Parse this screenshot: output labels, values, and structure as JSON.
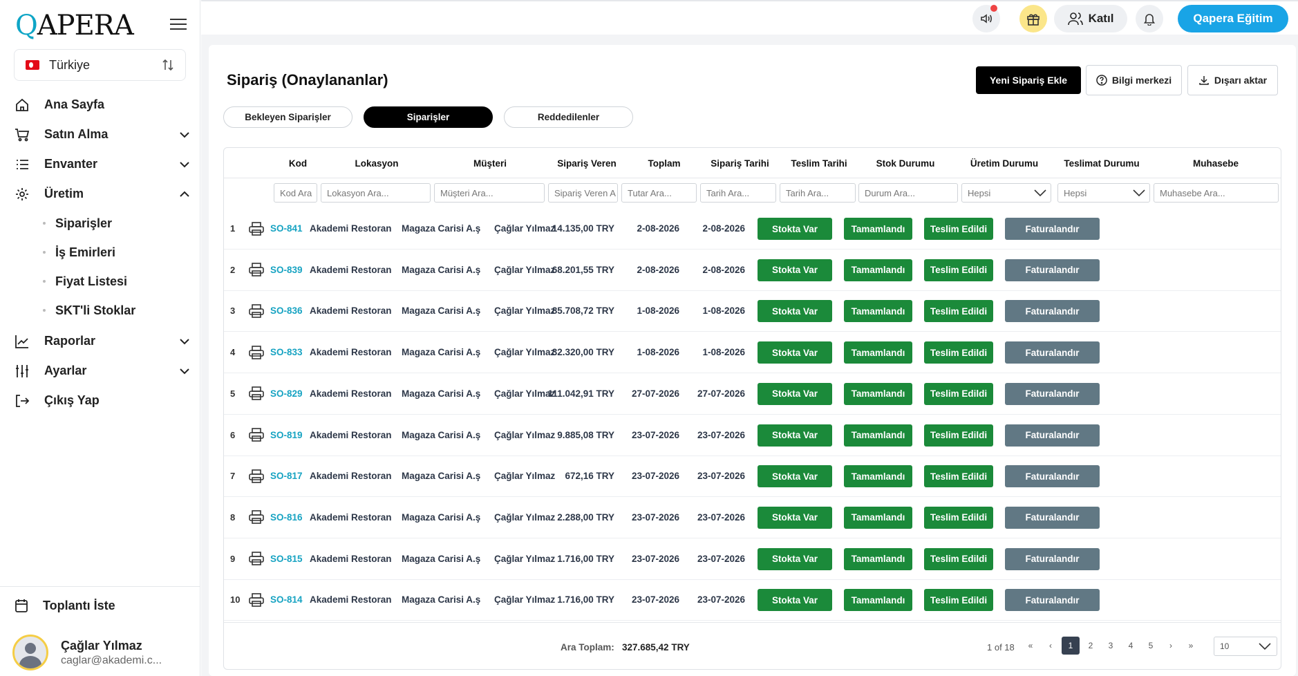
{
  "sidebar": {
    "logo": "QAPERA",
    "country": "Türkiye",
    "nav": [
      {
        "label": "Ana Sayfa",
        "icon": "home-icon"
      },
      {
        "label": "Satın Alma",
        "icon": "cart-icon"
      },
      {
        "label": "Envanter",
        "icon": "list-icon"
      },
      {
        "label": "Üretim",
        "icon": "gear-icon"
      }
    ],
    "sub": [
      "Siparişler",
      "İş Emirleri",
      "Fiyat Listesi",
      "SKT'li Stoklar"
    ],
    "nav2": [
      {
        "label": "Raporlar",
        "icon": "chart-icon"
      },
      {
        "label": "Ayarlar",
        "icon": "sliders-icon"
      },
      {
        "label": "Çıkış Yap",
        "icon": "logout-icon"
      }
    ],
    "meeting": "Toplantı İste",
    "user": {
      "name": "Çağlar Yılmaz",
      "email": "caglar@akademi.c..."
    }
  },
  "topbar": {
    "join": "Katıl",
    "qapera": "Qapera Eğitim"
  },
  "page": {
    "title": "Sipariş (Onaylananlar)",
    "new_order": "Yeni Sipariş Ekle",
    "help": "Bilgi merkezi",
    "export": "Dışarı aktar",
    "tabs": [
      "Bekleyen Siparişler",
      "Siparişler",
      "Reddedilenler"
    ]
  },
  "table": {
    "headers": [
      "Kod",
      "Lokasyon",
      "Müşteri",
      "Sipariş Veren",
      "Toplam",
      "Sipariş Tarihi",
      "Teslim Tarihi",
      "Stok Durumu",
      "Üretim Durumu",
      "Teslimat Durumu",
      "Muhasebe"
    ],
    "filters": [
      "Kod Ara",
      "Lokasyon Ara...",
      "Müşteri Ara...",
      "Sipariş Veren A",
      "Tutar Ara...",
      "Tarih Ara...",
      "Tarih Ara...",
      "Durum Ara...",
      "Hepsi",
      "Hepsi",
      "Muhasebe Ara..."
    ],
    "rows": [
      {
        "n": "1",
        "code": "SO-841",
        "loc": "Akademi Restoran",
        "cust": "Magaza Carisi A.ş",
        "by": "Çağlar Yılmaz",
        "total": "14.135,00 TRY",
        "odate": "2-08-2026",
        "ddate": "2-08-2026",
        "stock": "Stokta Var",
        "prod": "Tamamlandı",
        "deliv": "Teslim Edildi",
        "acc": "Faturalandır"
      },
      {
        "n": "2",
        "code": "SO-839",
        "loc": "Akademi Restoran",
        "cust": "Magaza Carisi A.ş",
        "by": "Çağlar Yılmaz",
        "total": "68.201,55 TRY",
        "odate": "2-08-2026",
        "ddate": "2-08-2026",
        "stock": "Stokta Var",
        "prod": "Tamamlandı",
        "deliv": "Teslim Edildi",
        "acc": "Faturalandır"
      },
      {
        "n": "3",
        "code": "SO-836",
        "loc": "Akademi Restoran",
        "cust": "Magaza Carisi A.ş",
        "by": "Çağlar Yılmaz",
        "total": "85.708,72 TRY",
        "odate": "1-08-2026",
        "ddate": "1-08-2026",
        "stock": "Stokta Var",
        "prod": "Tamamlandı",
        "deliv": "Teslim Edildi",
        "acc": "Faturalandır"
      },
      {
        "n": "4",
        "code": "SO-833",
        "loc": "Akademi Restoran",
        "cust": "Magaza Carisi A.ş",
        "by": "Çağlar Yılmaz",
        "total": "32.320,00 TRY",
        "odate": "1-08-2026",
        "ddate": "1-08-2026",
        "stock": "Stokta Var",
        "prod": "Tamamlandı",
        "deliv": "Teslim Edildi",
        "acc": "Faturalandır"
      },
      {
        "n": "5",
        "code": "SO-829",
        "loc": "Akademi Restoran",
        "cust": "Magaza Carisi A.ş",
        "by": "Çağlar Yılmaz",
        "total": "111.042,91 TRY",
        "odate": "27-07-2026",
        "ddate": "27-07-2026",
        "stock": "Stokta Var",
        "prod": "Tamamlandı",
        "deliv": "Teslim Edildi",
        "acc": "Faturalandır"
      },
      {
        "n": "6",
        "code": "SO-819",
        "loc": "Akademi Restoran",
        "cust": "Magaza Carisi A.ş",
        "by": "Çağlar Yılmaz",
        "total": "9.885,08 TRY",
        "odate": "23-07-2026",
        "ddate": "23-07-2026",
        "stock": "Stokta Var",
        "prod": "Tamamlandı",
        "deliv": "Teslim Edildi",
        "acc": "Faturalandır"
      },
      {
        "n": "7",
        "code": "SO-817",
        "loc": "Akademi Restoran",
        "cust": "Magaza Carisi A.ş",
        "by": "Çağlar Yılmaz",
        "total": "672,16 TRY",
        "odate": "23-07-2026",
        "ddate": "23-07-2026",
        "stock": "Stokta Var",
        "prod": "Tamamlandı",
        "deliv": "Teslim Edildi",
        "acc": "Faturalandır"
      },
      {
        "n": "8",
        "code": "SO-816",
        "loc": "Akademi Restoran",
        "cust": "Magaza Carisi A.ş",
        "by": "Çağlar Yılmaz",
        "total": "2.288,00 TRY",
        "odate": "23-07-2026",
        "ddate": "23-07-2026",
        "stock": "Stokta Var",
        "prod": "Tamamlandı",
        "deliv": "Teslim Edildi",
        "acc": "Faturalandır"
      },
      {
        "n": "9",
        "code": "SO-815",
        "loc": "Akademi Restoran",
        "cust": "Magaza Carisi A.ş",
        "by": "Çağlar Yılmaz",
        "total": "1.716,00 TRY",
        "odate": "23-07-2026",
        "ddate": "23-07-2026",
        "stock": "Stokta Var",
        "prod": "Tamamlandı",
        "deliv": "Teslim Edildi",
        "acc": "Faturalandır"
      },
      {
        "n": "10",
        "code": "SO-814",
        "loc": "Akademi Restoran",
        "cust": "Magaza Carisi A.ş",
        "by": "Çağlar Yılmaz",
        "total": "1.716,00 TRY",
        "odate": "23-07-2026",
        "ddate": "23-07-2026",
        "stock": "Stokta Var",
        "prod": "Tamamlandı",
        "deliv": "Teslim Edildi",
        "acc": "Faturalandır"
      }
    ],
    "footer": {
      "subtotal_label": "Ara Toplam:",
      "subtotal_value": "327.685,42 TRY",
      "page_info": "1 of 18",
      "pages": [
        "1",
        "2",
        "3",
        "4",
        "5"
      ],
      "first": "«",
      "prev": "‹",
      "next": "›",
      "last": "»",
      "page_size": "10"
    }
  },
  "colors": {
    "accent": "#19a4e6",
    "code_link": "#17a3c2",
    "status_green": "#1b8a3a",
    "status_grey": "#617884"
  }
}
